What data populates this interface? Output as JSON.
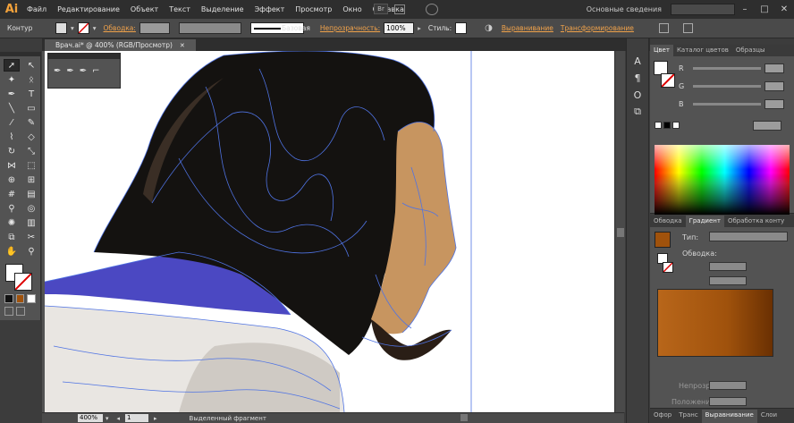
{
  "app": {
    "logo": "Ai"
  },
  "menu": [
    "Файл",
    "Редактирование",
    "Объект",
    "Текст",
    "Выделение",
    "Эффект",
    "Просмотр",
    "Окно",
    "Справка"
  ],
  "menubar_right": {
    "workspace": "Основные сведения",
    "win_min": "–",
    "win_max": "□",
    "win_close": "✕",
    "br_label": "Br"
  },
  "control_bar": {
    "selection_label": "Контур",
    "stroke_link": "Обводка:",
    "stroke_style": "Базовая",
    "opacity_link": "Непрозрачность:",
    "opacity_value": "100%",
    "styles_label": "Стиль:",
    "align_link": "Выравнивание",
    "transform_link": "Трансформирование"
  },
  "document": {
    "tab_title": "Врач.ai* @ 400% (RGB/Просмотр)",
    "close": "✕"
  },
  "status": {
    "zoom": "400%",
    "page": "1",
    "selection": "Выделенный фрагмент"
  },
  "color_panel": {
    "tabs": [
      "Цвет",
      "Каталог цветов",
      "Образцы"
    ],
    "channels": [
      "R",
      "G",
      "B"
    ]
  },
  "gradient_panel": {
    "tabs": [
      "Обводка",
      "Градиент",
      "Обработка конту"
    ],
    "type_label": "Тип:",
    "stroke_label": "Обводка:",
    "opacity_label": "Непрозр.:",
    "position_label": "Положение:"
  },
  "bottom_tabs": [
    "Офор",
    "Транс",
    "Выравнивание",
    "Слои"
  ],
  "colors": {
    "accent_orange": "#f0a24a",
    "gradient_fill": "#a0520c",
    "path_blue": "#4f73e3"
  }
}
